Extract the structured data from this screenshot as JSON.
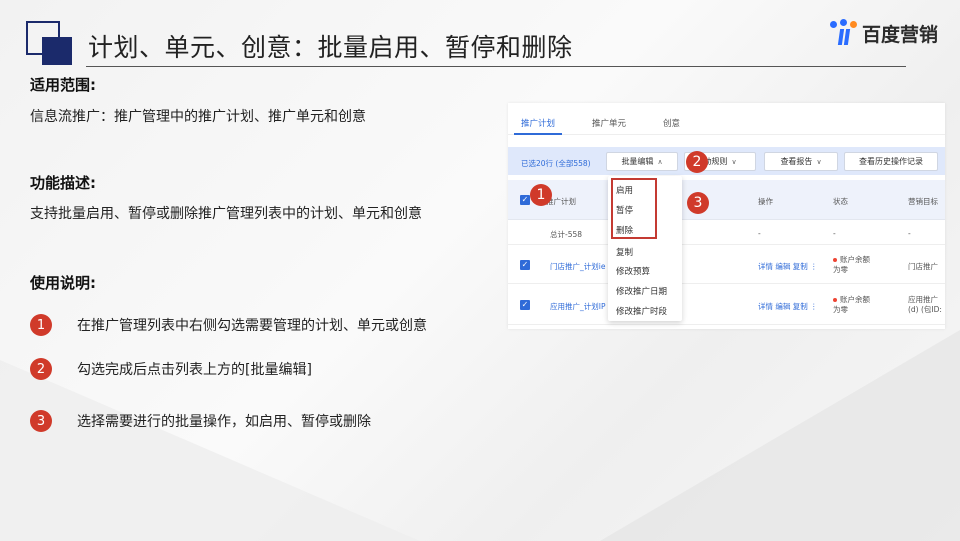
{
  "header": {
    "title": "计划、单元、创意：批量启用、暂停和删除",
    "brand": "百度营销"
  },
  "sections": {
    "scope_heading": "适用范围:",
    "scope_text": "信息流推广：推广管理中的推广计划、推广单元和创意",
    "func_heading": "功能描述:",
    "func_text": "支持批量启用、暂停或删除推广管理列表中的计划、单元和创意",
    "usage_heading": "使用说明:"
  },
  "steps": [
    {
      "num": "1",
      "text": "在推广管理列表中右侧勾选需要管理的计划、单元或创意"
    },
    {
      "num": "2",
      "text": "勾选完成后点击列表上方的[批量编辑]"
    },
    {
      "num": "3",
      "text": "选择需要进行的批量操作，如启用、暂停或删除"
    }
  ],
  "screenshot": {
    "tabs": [
      "推广计划",
      "推广单元",
      "创意"
    ],
    "selected_info": "已选20行 (全部558)",
    "toolbar_buttons": {
      "batch_edit": "批量编辑",
      "auto_rule": "动规则",
      "view_report": "查看报告",
      "history": "查看历史操作记录"
    },
    "table_headers": {
      "plan": "推广计划",
      "ops": "操作",
      "status": "状态",
      "goal": "营销目标"
    },
    "total_row": {
      "label": "总计-558",
      "dash": "-"
    },
    "rows": [
      {
        "name": "门店推广_计划ie",
        "ops": "详情  编辑  复制  ⋮",
        "status": "账户余额为零",
        "goal": "门店推广"
      },
      {
        "name": "应用推广_计划IP",
        "ops": "详情  编辑  复制  ⋮",
        "status": "账户余额为零",
        "goal": "应用推广 (d) (包ID:"
      }
    ],
    "dropdown_items": [
      "启用",
      "暂停",
      "删除",
      "复制",
      "修改预算",
      "修改推广日期",
      "修改推广时段"
    ],
    "badges": [
      "1",
      "2",
      "3"
    ]
  },
  "colors": {
    "accent": "#1b2a6b",
    "badge": "#d03a2a",
    "link": "#2f6bd8",
    "highlight_box": "#c43a32"
  }
}
